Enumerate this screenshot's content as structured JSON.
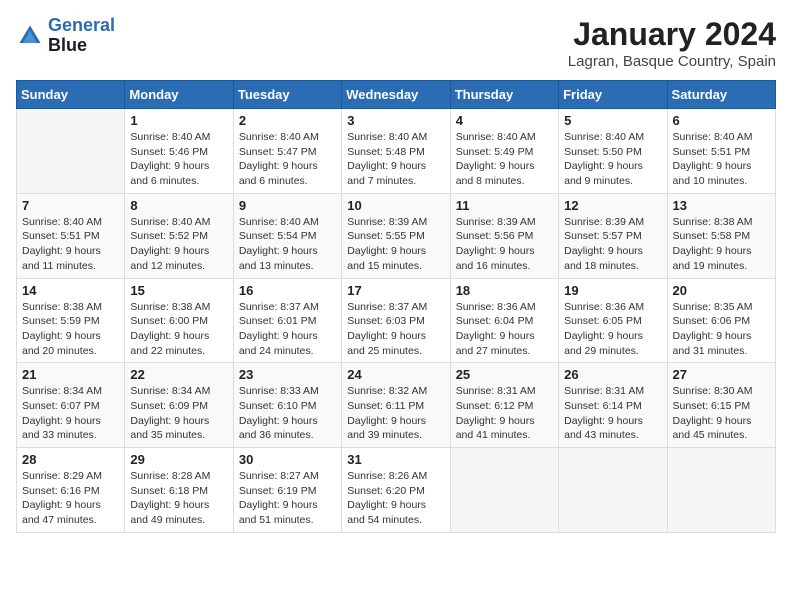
{
  "header": {
    "logo_line1": "General",
    "logo_line2": "Blue",
    "month_title": "January 2024",
    "location": "Lagran, Basque Country, Spain"
  },
  "days_of_week": [
    "Sunday",
    "Monday",
    "Tuesday",
    "Wednesday",
    "Thursday",
    "Friday",
    "Saturday"
  ],
  "weeks": [
    [
      {
        "day": "",
        "sunrise": "",
        "sunset": "",
        "daylight": ""
      },
      {
        "day": "1",
        "sunrise": "Sunrise: 8:40 AM",
        "sunset": "Sunset: 5:46 PM",
        "daylight": "Daylight: 9 hours and 6 minutes."
      },
      {
        "day": "2",
        "sunrise": "Sunrise: 8:40 AM",
        "sunset": "Sunset: 5:47 PM",
        "daylight": "Daylight: 9 hours and 6 minutes."
      },
      {
        "day": "3",
        "sunrise": "Sunrise: 8:40 AM",
        "sunset": "Sunset: 5:48 PM",
        "daylight": "Daylight: 9 hours and 7 minutes."
      },
      {
        "day": "4",
        "sunrise": "Sunrise: 8:40 AM",
        "sunset": "Sunset: 5:49 PM",
        "daylight": "Daylight: 9 hours and 8 minutes."
      },
      {
        "day": "5",
        "sunrise": "Sunrise: 8:40 AM",
        "sunset": "Sunset: 5:50 PM",
        "daylight": "Daylight: 9 hours and 9 minutes."
      },
      {
        "day": "6",
        "sunrise": "Sunrise: 8:40 AM",
        "sunset": "Sunset: 5:51 PM",
        "daylight": "Daylight: 9 hours and 10 minutes."
      }
    ],
    [
      {
        "day": "7",
        "sunrise": "Sunrise: 8:40 AM",
        "sunset": "Sunset: 5:51 PM",
        "daylight": "Daylight: 9 hours and 11 minutes."
      },
      {
        "day": "8",
        "sunrise": "Sunrise: 8:40 AM",
        "sunset": "Sunset: 5:52 PM",
        "daylight": "Daylight: 9 hours and 12 minutes."
      },
      {
        "day": "9",
        "sunrise": "Sunrise: 8:40 AM",
        "sunset": "Sunset: 5:54 PM",
        "daylight": "Daylight: 9 hours and 13 minutes."
      },
      {
        "day": "10",
        "sunrise": "Sunrise: 8:39 AM",
        "sunset": "Sunset: 5:55 PM",
        "daylight": "Daylight: 9 hours and 15 minutes."
      },
      {
        "day": "11",
        "sunrise": "Sunrise: 8:39 AM",
        "sunset": "Sunset: 5:56 PM",
        "daylight": "Daylight: 9 hours and 16 minutes."
      },
      {
        "day": "12",
        "sunrise": "Sunrise: 8:39 AM",
        "sunset": "Sunset: 5:57 PM",
        "daylight": "Daylight: 9 hours and 18 minutes."
      },
      {
        "day": "13",
        "sunrise": "Sunrise: 8:38 AM",
        "sunset": "Sunset: 5:58 PM",
        "daylight": "Daylight: 9 hours and 19 minutes."
      }
    ],
    [
      {
        "day": "14",
        "sunrise": "Sunrise: 8:38 AM",
        "sunset": "Sunset: 5:59 PM",
        "daylight": "Daylight: 9 hours and 20 minutes."
      },
      {
        "day": "15",
        "sunrise": "Sunrise: 8:38 AM",
        "sunset": "Sunset: 6:00 PM",
        "daylight": "Daylight: 9 hours and 22 minutes."
      },
      {
        "day": "16",
        "sunrise": "Sunrise: 8:37 AM",
        "sunset": "Sunset: 6:01 PM",
        "daylight": "Daylight: 9 hours and 24 minutes."
      },
      {
        "day": "17",
        "sunrise": "Sunrise: 8:37 AM",
        "sunset": "Sunset: 6:03 PM",
        "daylight": "Daylight: 9 hours and 25 minutes."
      },
      {
        "day": "18",
        "sunrise": "Sunrise: 8:36 AM",
        "sunset": "Sunset: 6:04 PM",
        "daylight": "Daylight: 9 hours and 27 minutes."
      },
      {
        "day": "19",
        "sunrise": "Sunrise: 8:36 AM",
        "sunset": "Sunset: 6:05 PM",
        "daylight": "Daylight: 9 hours and 29 minutes."
      },
      {
        "day": "20",
        "sunrise": "Sunrise: 8:35 AM",
        "sunset": "Sunset: 6:06 PM",
        "daylight": "Daylight: 9 hours and 31 minutes."
      }
    ],
    [
      {
        "day": "21",
        "sunrise": "Sunrise: 8:34 AM",
        "sunset": "Sunset: 6:07 PM",
        "daylight": "Daylight: 9 hours and 33 minutes."
      },
      {
        "day": "22",
        "sunrise": "Sunrise: 8:34 AM",
        "sunset": "Sunset: 6:09 PM",
        "daylight": "Daylight: 9 hours and 35 minutes."
      },
      {
        "day": "23",
        "sunrise": "Sunrise: 8:33 AM",
        "sunset": "Sunset: 6:10 PM",
        "daylight": "Daylight: 9 hours and 36 minutes."
      },
      {
        "day": "24",
        "sunrise": "Sunrise: 8:32 AM",
        "sunset": "Sunset: 6:11 PM",
        "daylight": "Daylight: 9 hours and 39 minutes."
      },
      {
        "day": "25",
        "sunrise": "Sunrise: 8:31 AM",
        "sunset": "Sunset: 6:12 PM",
        "daylight": "Daylight: 9 hours and 41 minutes."
      },
      {
        "day": "26",
        "sunrise": "Sunrise: 8:31 AM",
        "sunset": "Sunset: 6:14 PM",
        "daylight": "Daylight: 9 hours and 43 minutes."
      },
      {
        "day": "27",
        "sunrise": "Sunrise: 8:30 AM",
        "sunset": "Sunset: 6:15 PM",
        "daylight": "Daylight: 9 hours and 45 minutes."
      }
    ],
    [
      {
        "day": "28",
        "sunrise": "Sunrise: 8:29 AM",
        "sunset": "Sunset: 6:16 PM",
        "daylight": "Daylight: 9 hours and 47 minutes."
      },
      {
        "day": "29",
        "sunrise": "Sunrise: 8:28 AM",
        "sunset": "Sunset: 6:18 PM",
        "daylight": "Daylight: 9 hours and 49 minutes."
      },
      {
        "day": "30",
        "sunrise": "Sunrise: 8:27 AM",
        "sunset": "Sunset: 6:19 PM",
        "daylight": "Daylight: 9 hours and 51 minutes."
      },
      {
        "day": "31",
        "sunrise": "Sunrise: 8:26 AM",
        "sunset": "Sunset: 6:20 PM",
        "daylight": "Daylight: 9 hours and 54 minutes."
      },
      {
        "day": "",
        "sunrise": "",
        "sunset": "",
        "daylight": ""
      },
      {
        "day": "",
        "sunrise": "",
        "sunset": "",
        "daylight": ""
      },
      {
        "day": "",
        "sunrise": "",
        "sunset": "",
        "daylight": ""
      }
    ]
  ]
}
